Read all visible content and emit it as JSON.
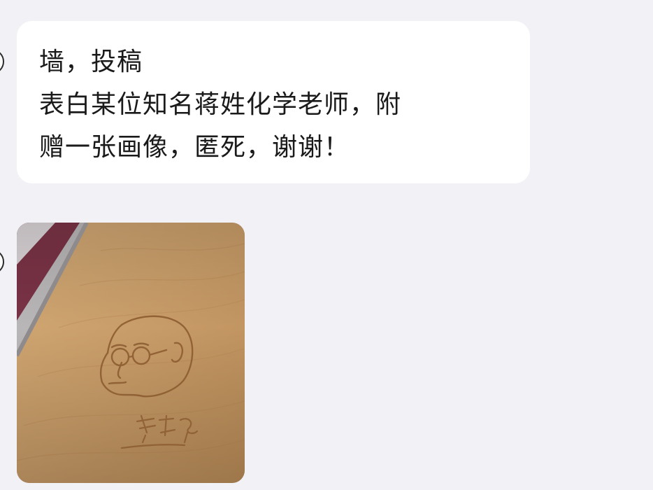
{
  "chat": {
    "messages": [
      {
        "type": "text",
        "lines": [
          "墙，投稿",
          "表白某位知名蒋姓化学老师，附",
          "赠一张画像，匿死，谢谢！"
        ]
      },
      {
        "type": "image",
        "image_subject": "portrait-sketch-engraved-on-wooden-board",
        "engraved_signature": "蒋杰炜"
      }
    ]
  },
  "colors": {
    "background": "#f2f1f6",
    "bubble": "#ffffff",
    "text": "#1a1a1a",
    "wood": "#c9a06d",
    "engraving": "#8a5a2e"
  }
}
